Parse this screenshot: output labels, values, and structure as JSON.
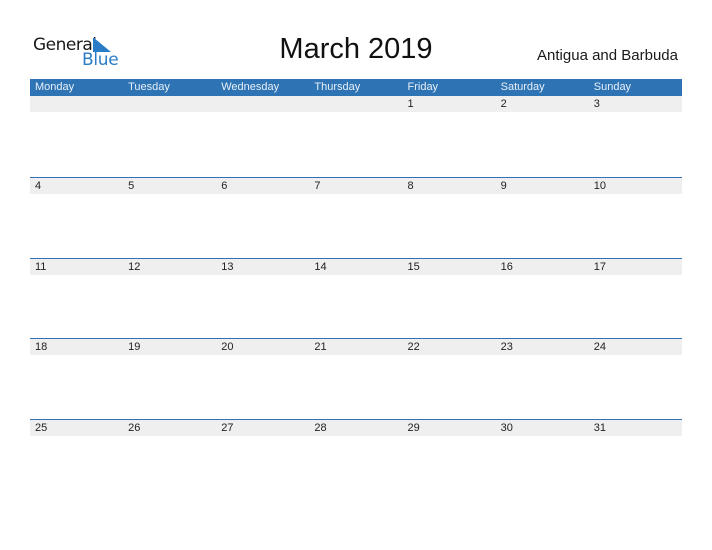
{
  "logo": {
    "text_general": "General",
    "text_blue": "Blue",
    "icon": "triangle-flag-icon",
    "brand_color": "#2a7cc7"
  },
  "title": "March 2019",
  "country": "Antigua and Barbuda",
  "colors": {
    "header_bg": "#2e74b5",
    "date_band_bg": "#efefef",
    "separator": "#2e74b5"
  },
  "weekdays": [
    "Monday",
    "Tuesday",
    "Wednesday",
    "Thursday",
    "Friday",
    "Saturday",
    "Sunday"
  ],
  "weeks": [
    [
      "",
      "",
      "",
      "",
      "1",
      "2",
      "3"
    ],
    [
      "4",
      "5",
      "6",
      "7",
      "8",
      "9",
      "10"
    ],
    [
      "11",
      "12",
      "13",
      "14",
      "15",
      "16",
      "17"
    ],
    [
      "18",
      "19",
      "20",
      "21",
      "22",
      "23",
      "24"
    ],
    [
      "25",
      "26",
      "27",
      "28",
      "29",
      "30",
      "31"
    ]
  ]
}
